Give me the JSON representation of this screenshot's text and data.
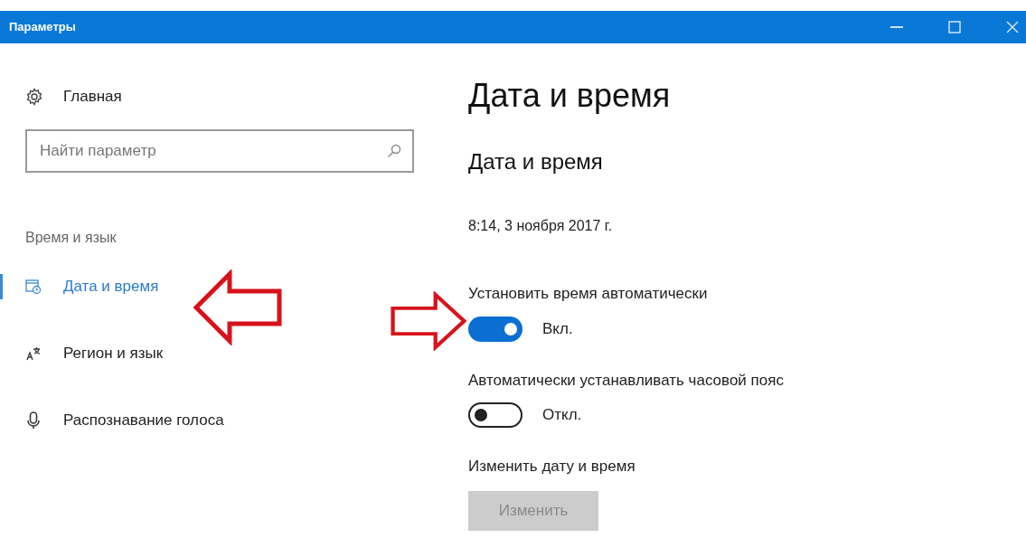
{
  "window": {
    "title": "Параметры"
  },
  "sidebar": {
    "home": "Главная",
    "search": {
      "placeholder": "Найти параметр"
    },
    "section": "Время и язык",
    "items": [
      {
        "label": "Дата и время",
        "selected": true
      },
      {
        "label": "Регион и язык",
        "selected": false
      },
      {
        "label": "Распознавание голоса",
        "selected": false
      }
    ]
  },
  "main": {
    "title": "Дата и время",
    "subtitle": "Дата и время",
    "current_time": "8:14, 3 ноября 2017 г.",
    "settings": [
      {
        "kind": "toggle",
        "label": "Установить время автоматически",
        "on": true,
        "state_text": "Вкл."
      },
      {
        "kind": "toggle",
        "label": "Автоматически устанавливать часовой пояс",
        "on": false,
        "state_text": "Откл."
      },
      {
        "kind": "button",
        "label": "Изменить дату и время",
        "button": "Изменить",
        "disabled": true
      }
    ]
  }
}
